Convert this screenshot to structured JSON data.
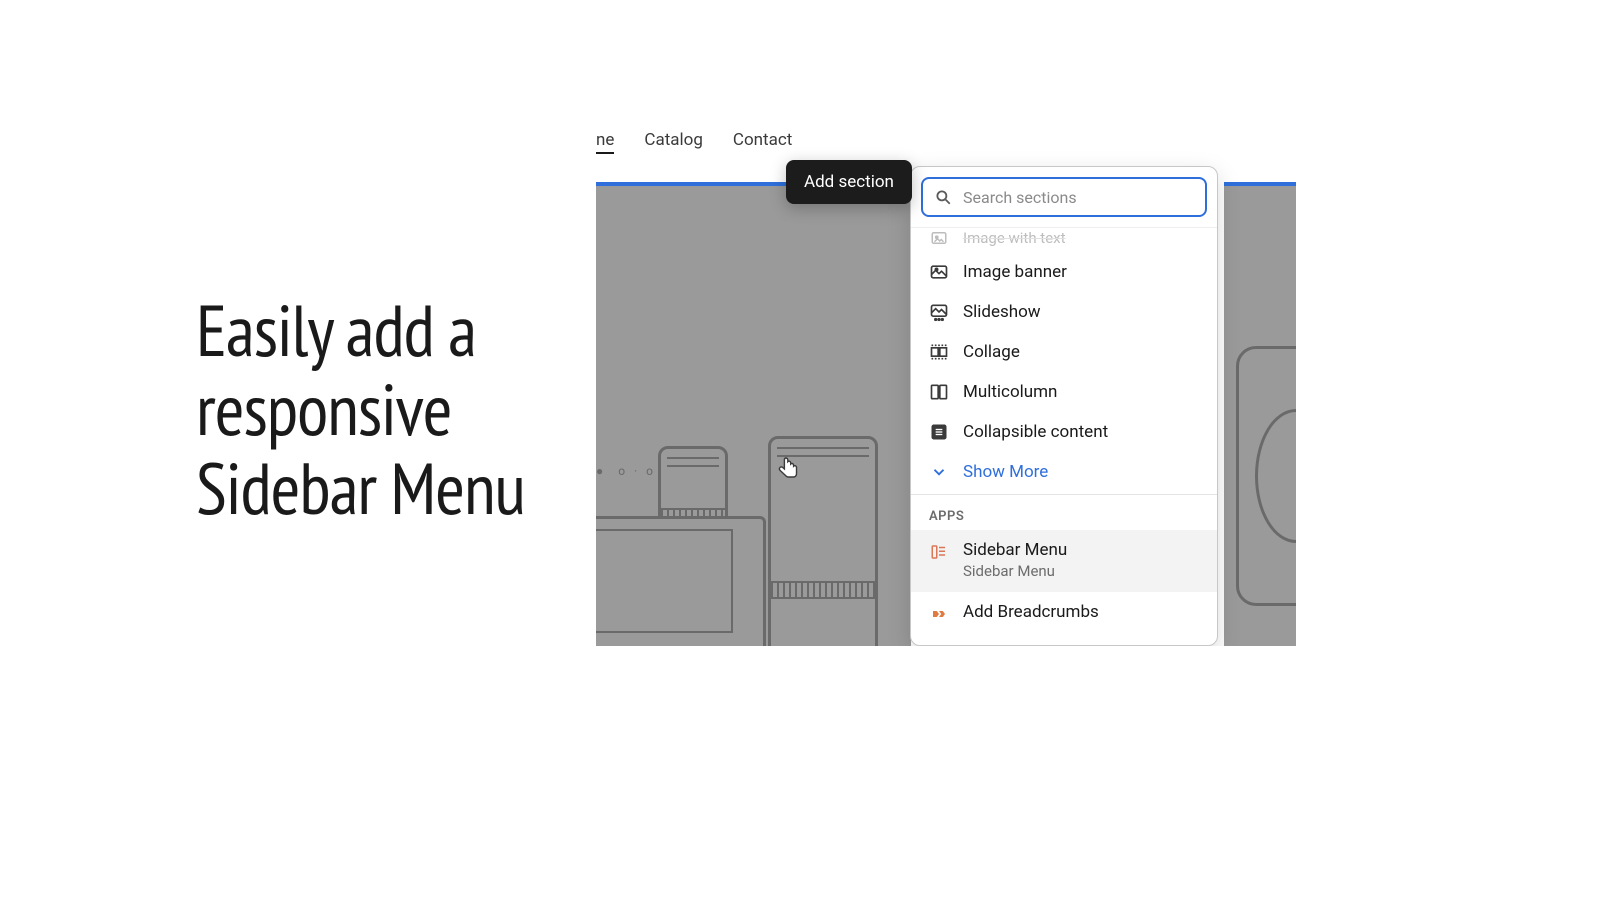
{
  "headline": "Easily add a \nresponsive \nSidebar Menu",
  "nav": {
    "home": "ne",
    "catalog": "Catalog",
    "contact": "Contact"
  },
  "tooltip": "Add section",
  "search": {
    "placeholder": "Search sections",
    "value": ""
  },
  "sections": {
    "ghost": "Image with text",
    "items": [
      {
        "label": "Image banner"
      },
      {
        "label": "Slideshow"
      },
      {
        "label": "Collage"
      },
      {
        "label": "Multicolumn"
      },
      {
        "label": "Collapsible content"
      }
    ],
    "showMore": "Show More"
  },
  "apps": {
    "label": "APPS",
    "items": [
      {
        "title": "Sidebar Menu",
        "subtitle": "Sidebar Menu"
      },
      {
        "title": "Add Breadcrumbs"
      }
    ]
  }
}
